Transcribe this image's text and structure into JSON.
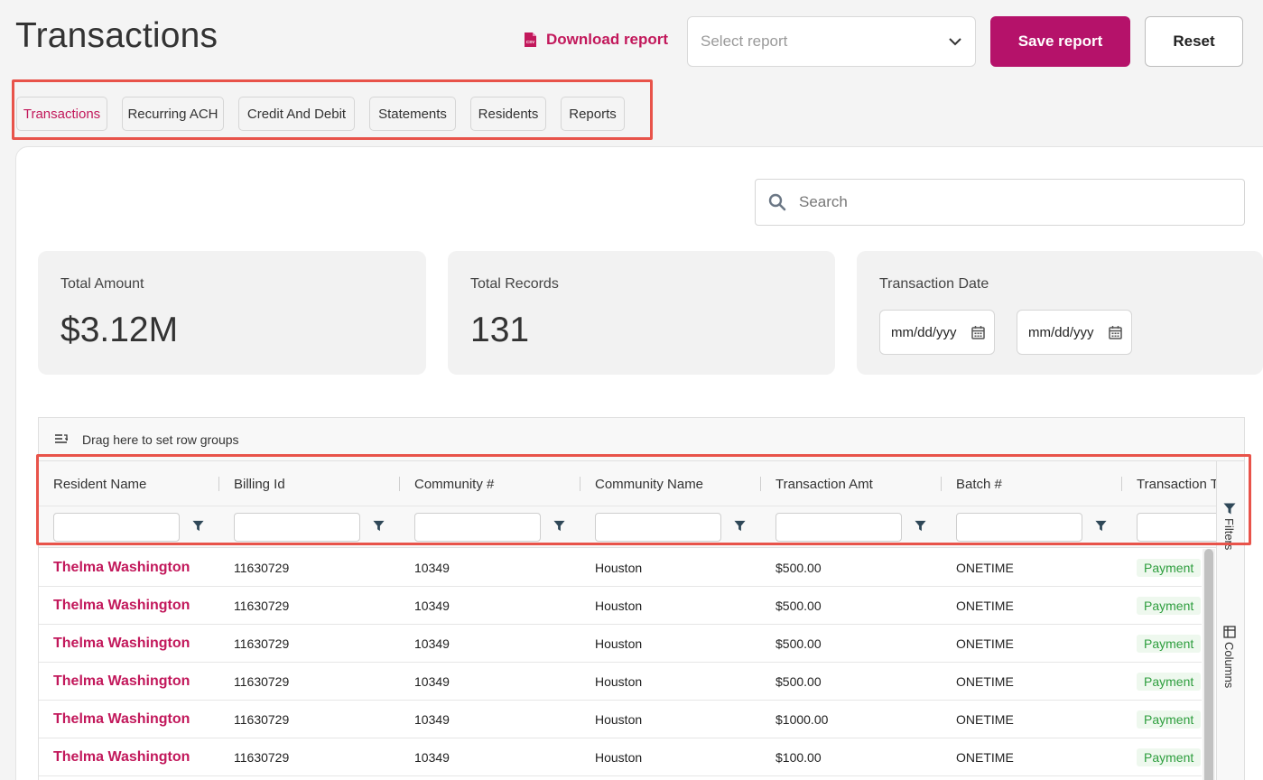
{
  "header": {
    "title": "Transactions",
    "download_label": "Download report",
    "select_placeholder": "Select report",
    "save_label": "Save report",
    "reset_label": "Reset"
  },
  "tabs": [
    {
      "label": "Transactions",
      "active": true
    },
    {
      "label": "Recurring ACH",
      "active": false
    },
    {
      "label": "Credit And Debit",
      "active": false
    },
    {
      "label": "Statements",
      "active": false
    },
    {
      "label": "Residents",
      "active": false
    },
    {
      "label": "Reports",
      "active": false
    }
  ],
  "search": {
    "placeholder": "Search"
  },
  "stats": {
    "total_amount_label": "Total Amount",
    "total_amount_value": "$3.12M",
    "total_records_label": "Total Records",
    "total_records_value": "131",
    "date_label": "Transaction Date",
    "date_from_placeholder": "mm/dd/yyy",
    "date_to_placeholder": "mm/dd/yyy"
  },
  "grid": {
    "group_bar_text": "Drag here to set row groups",
    "columns": [
      "Resident Name",
      "Billing Id",
      "Community #",
      "Community Name",
      "Transaction Amt",
      "Batch #",
      "Transaction T"
    ],
    "rows": [
      [
        "Thelma Washington",
        "11630729",
        "10349",
        "Houston",
        "$500.00",
        "ONETIME",
        "Payment"
      ],
      [
        "Thelma Washington",
        "11630729",
        "10349",
        "Houston",
        "$500.00",
        "ONETIME",
        "Payment"
      ],
      [
        "Thelma Washington",
        "11630729",
        "10349",
        "Houston",
        "$500.00",
        "ONETIME",
        "Payment"
      ],
      [
        "Thelma Washington",
        "11630729",
        "10349",
        "Houston",
        "$500.00",
        "ONETIME",
        "Payment"
      ],
      [
        "Thelma Washington",
        "11630729",
        "10349",
        "Houston",
        "$1000.00",
        "ONETIME",
        "Payment"
      ],
      [
        "Thelma Washington",
        "11630729",
        "10349",
        "Houston",
        "$100.00",
        "ONETIME",
        "Payment"
      ]
    ],
    "side_panel": {
      "filters_label": "Filters",
      "columns_label": "Columns"
    }
  },
  "colors": {
    "accent": "#b5126a",
    "highlight": "#e8534a",
    "payment": "#2e9e3e"
  }
}
